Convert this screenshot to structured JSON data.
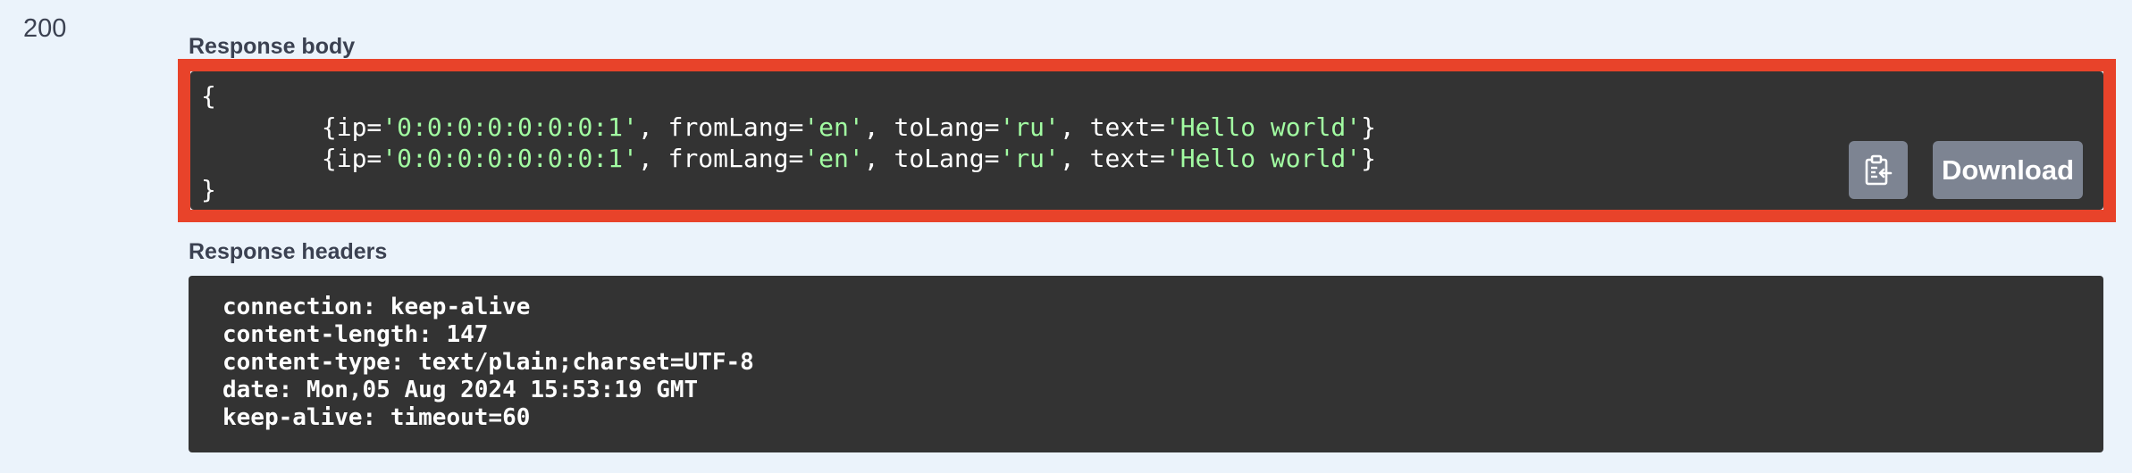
{
  "status_code": "200",
  "response_body": {
    "label": "Response body",
    "open_brace": "{",
    "close_brace": "}",
    "lines": [
      {
        "indent": "        ",
        "prefix": "{ip=",
        "ip": "'0:0:0:0:0:0:0:1'",
        "from_key": ", fromLang=",
        "from_val": "'en'",
        "to_key": ", toLang=",
        "to_val": "'ru'",
        "text_key": ", text=",
        "text_val": "'Hello world'",
        "suffix": "}"
      },
      {
        "indent": "        ",
        "prefix": "{ip=",
        "ip": "'0:0:0:0:0:0:0:1'",
        "from_key": ", fromLang=",
        "from_val": "'en'",
        "to_key": ", toLang=",
        "to_val": "'ru'",
        "text_key": ", text=",
        "text_val": "'Hello world'",
        "suffix": "}"
      }
    ],
    "copy_icon": "clipboard-copy-icon",
    "download_label": "Download"
  },
  "response_headers": {
    "label": "Response headers",
    "lines": [
      "connection: keep-alive",
      "content-length: 147",
      "content-type: text/plain;charset=UTF-8",
      "date: Mon,05 Aug 2024 15:53:19 GMT",
      "keep-alive: timeout=60"
    ]
  },
  "colors": {
    "page_background": "#ebf3fb",
    "code_background": "#333333",
    "string_token": "#a2fca2",
    "highlight_border": "#e8432a",
    "button_background": "#7d8492"
  }
}
